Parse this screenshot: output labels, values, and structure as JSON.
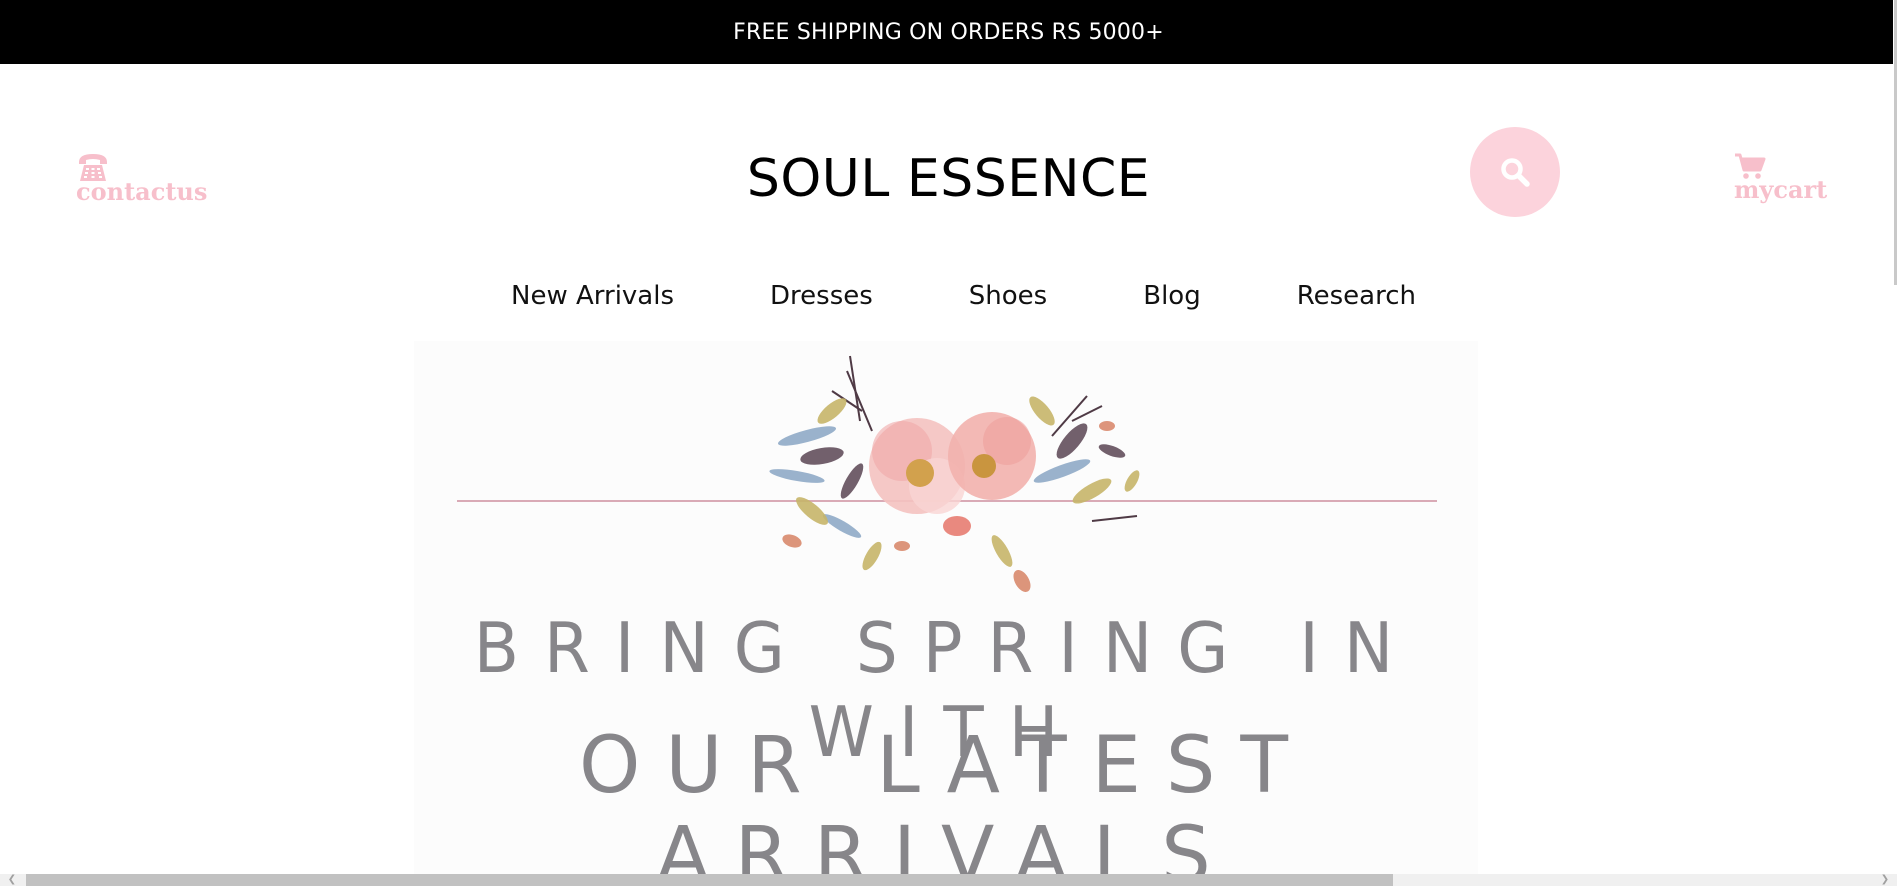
{
  "promo": {
    "text": "FREE SHIPPING ON ORDERS RS 5000+"
  },
  "header": {
    "contact_label": "contactus",
    "contact_icon": "phone-icon",
    "brand": "SOUL ESSENCE",
    "search_icon": "search-icon",
    "cart_label": "mycart",
    "cart_icon": "cart-icon"
  },
  "nav": {
    "items": [
      {
        "label": "New Arrivals"
      },
      {
        "label": "Dresses"
      },
      {
        "label": "Shoes"
      },
      {
        "label": "Blog"
      },
      {
        "label": "Research"
      }
    ]
  },
  "hero": {
    "line1": "BRING SPRING IN WITH",
    "line2": "OUR LATEST ARRIVALS"
  },
  "colors": {
    "accent_pink": "#f7bfcb",
    "search_bg": "#fcd3dc",
    "hero_text": "#87868a",
    "promo_bg": "#000000"
  }
}
